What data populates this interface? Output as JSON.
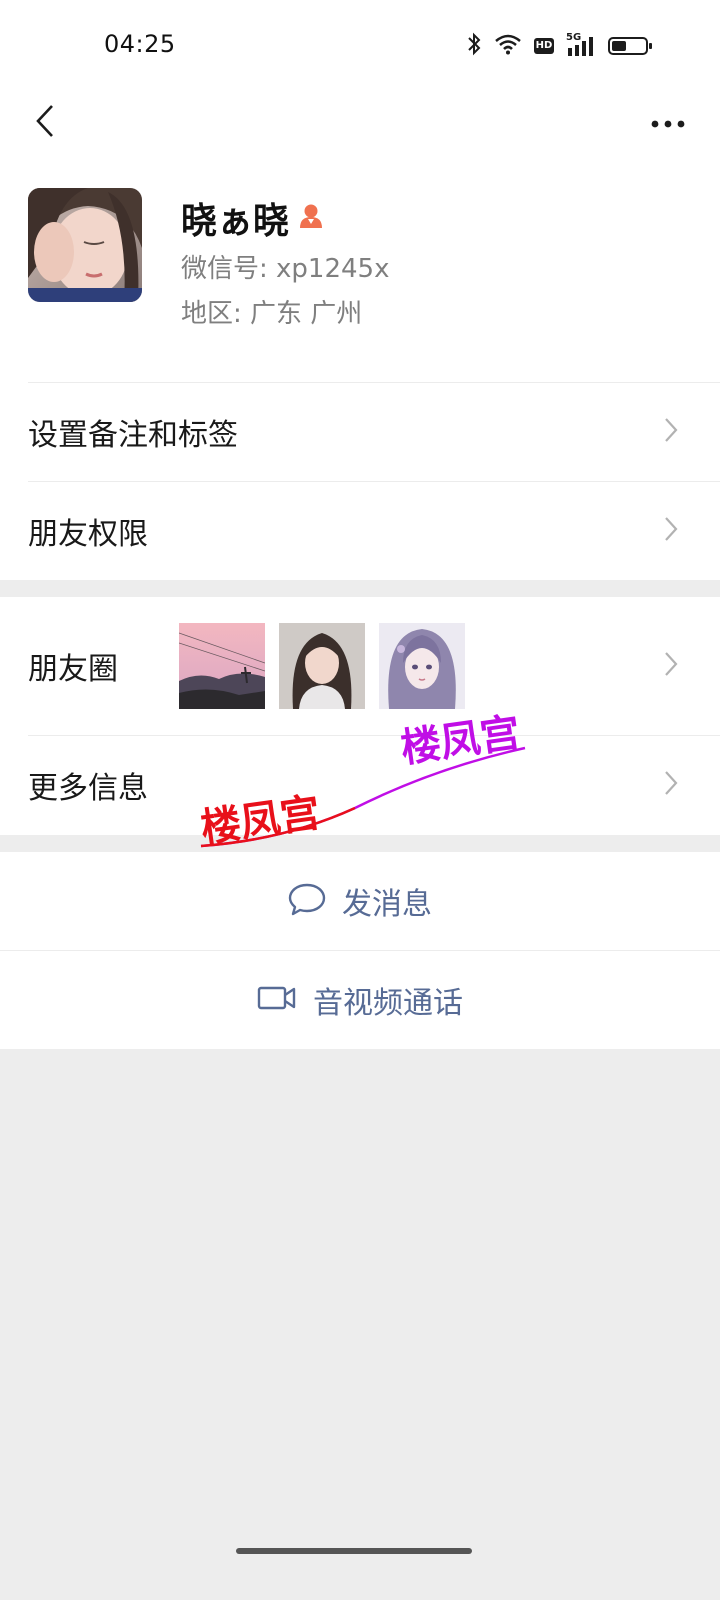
{
  "status_bar": {
    "time": "04:25",
    "icons": [
      "bluetooth-icon",
      "wifi-icon",
      "hd-icon",
      "5g-signal-icon",
      "battery-icon"
    ],
    "hd_label": "HD",
    "network_label": "5G"
  },
  "nav": {
    "back_icon": "chevron-left-icon",
    "more_icon": "more-dots-icon"
  },
  "profile": {
    "nickname": "晓ぁ晓",
    "gender_icon": "female-person-icon",
    "gender_color": "#f0714f",
    "wechat_id_line": "微信号:  xp1245x",
    "region_line": "地区:  广东  广州"
  },
  "rows": {
    "remarks_tags": "设置备注和标签",
    "friend_permissions": "朋友权限",
    "moments": "朋友圈",
    "more_info": "更多信息"
  },
  "actions": {
    "send_message": "发消息",
    "video_call": "音视频通话"
  },
  "watermark": {
    "text_left": "楼凤宫",
    "text_right": "楼凤宫",
    "color_left": "#e8101a",
    "color_right": "#c00ee6"
  },
  "colors": {
    "link_blue": "#576b95",
    "background": "#ededed"
  }
}
